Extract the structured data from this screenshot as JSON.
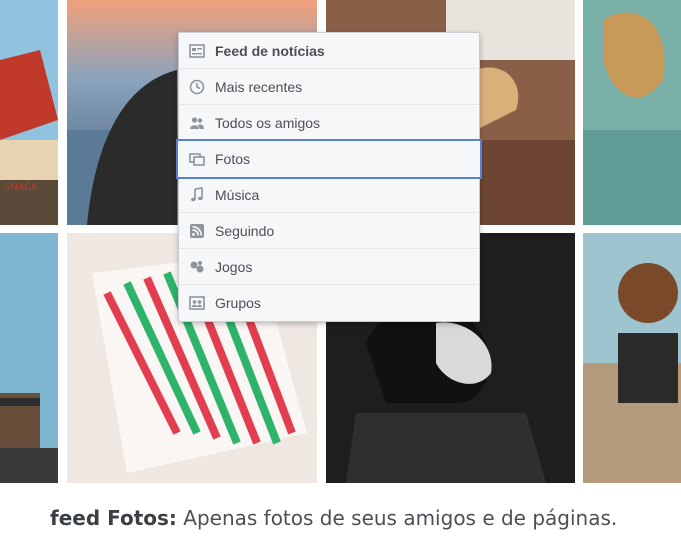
{
  "menu": {
    "items": [
      {
        "label": "Feed de notícias",
        "icon": "news-feed-icon"
      },
      {
        "label": "Mais recentes",
        "icon": "clock-icon"
      },
      {
        "label": "Todos os amigos",
        "icon": "friends-icon"
      },
      {
        "label": "Fotos",
        "icon": "photos-icon",
        "selected": true
      },
      {
        "label": "Música",
        "icon": "music-note-icon"
      },
      {
        "label": "Seguindo",
        "icon": "rss-icon"
      },
      {
        "label": "Jogos",
        "icon": "gamepad-icon"
      },
      {
        "label": "Grupos",
        "icon": "groups-icon"
      }
    ]
  },
  "caption": {
    "bold": "feed Fotos:",
    "text": " Apenas fotos de seus amigos e de páginas."
  },
  "colors": {
    "selected_outline": "#5b7fd4",
    "menu_background": "#f6f7f9",
    "text": "#4b4f56"
  }
}
